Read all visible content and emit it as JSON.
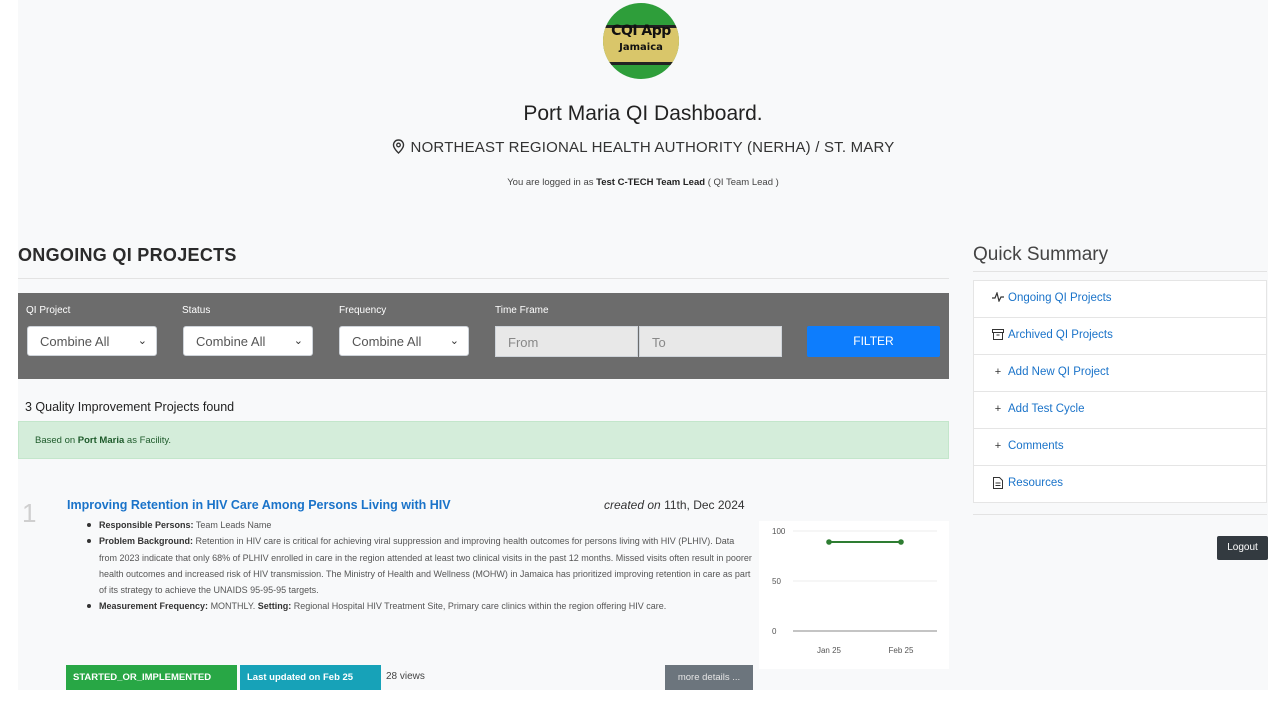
{
  "header": {
    "logo_line1": "CQI App",
    "logo_line2": "Jamaica",
    "title": "Port Maria QI Dashboard.",
    "location": "NORTHEAST REGIONAL HEALTH AUTHORITY (NERHA) / ST. MARY",
    "logged_in_prefix": "You are logged in as",
    "user": "Test C-TECH Team Lead",
    "role": "( QI Team Lead )"
  },
  "main": {
    "section_title": "ONGOING QI PROJECTS",
    "filters": {
      "qi_project_label": "QI Project",
      "qi_project_value": "Combine All",
      "status_label": "Status",
      "status_value": "Combine All",
      "frequency_label": "Frequency",
      "frequency_value": "Combine All",
      "timeframe_label": "Time Frame",
      "from_placeholder": "From",
      "to_placeholder": "To",
      "filter_button": "FILTER"
    },
    "found_text": "3 Quality Improvement Projects found",
    "alert": {
      "prefix": "Based on",
      "facility": "Port Maria",
      "suffix": "as Facility."
    },
    "project": {
      "number": "1",
      "title": "Improving Retention in HIV Care Among Persons Living with HIV",
      "created_prefix": "created on",
      "created_date": "11th, Dec 2024",
      "responsible_label": "Responsible Persons:",
      "responsible_value": "Team Leads Name",
      "background_label": "Problem Background:",
      "background_value": "Retention in HIV care is critical for achieving viral suppression and improving health outcomes for persons living with HIV (PLHIV). Data from 2023 indicate that only 68% of PLHIV enrolled in care in the region attended at least two clinical visits in the past 12 months. Missed visits often result in poorer health outcomes and increased risk of HIV transmission. The Ministry of Health and Wellness (MOHW) in Jamaica has prioritized improving retention in care as part of its strategy to achieve the UNAIDS 95-95-95 targets.",
      "frequency_label": "Measurement Frequency:",
      "frequency_value": "MONTHLY.",
      "setting_label": "Setting:",
      "setting_value": "Regional Hospital HIV Treatment Site, Primary care clinics within the region offering HIV care.",
      "status_badge": "STARTED_OR_IMPLEMENTED",
      "updated_badge": "Last updated on Feb 25",
      "views": "28 views",
      "more_button": "more details ..."
    }
  },
  "sidebar": {
    "title": "Quick Summary",
    "items": [
      {
        "icon": "activity-icon",
        "label": "Ongoing QI Projects"
      },
      {
        "icon": "archive-icon",
        "label": "Archived QI Projects"
      },
      {
        "icon": "plus-icon",
        "label": "Add New QI Project"
      },
      {
        "icon": "plus-icon",
        "label": "Add Test Cycle"
      },
      {
        "icon": "plus-icon",
        "label": "Comments"
      },
      {
        "icon": "document-icon",
        "label": "Resources"
      }
    ],
    "logout": "Logout"
  },
  "colors": {
    "link": "#1a73c9",
    "primary": "#0d7dfd",
    "success": "#28a745",
    "info": "#17a2b8",
    "series": "#2e7d32"
  },
  "chart_data": {
    "type": "line",
    "categories": [
      "Jan 25",
      "Feb 25"
    ],
    "series": [
      {
        "values": [
          89,
          89
        ]
      }
    ],
    "y_ticks": [
      "0",
      "50",
      "100"
    ],
    "ylim": [
      0,
      100
    ],
    "grid": true
  }
}
